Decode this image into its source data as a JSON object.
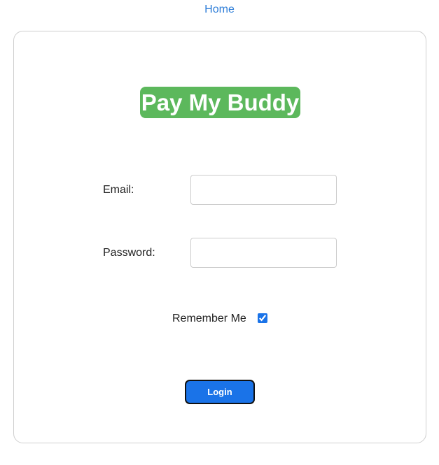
{
  "nav": {
    "home_label": "Home"
  },
  "brand": {
    "title": "Pay My Buddy",
    "color": "#5cb85c"
  },
  "form": {
    "email_label": "Email:",
    "email_value": "",
    "email_placeholder": "",
    "password_label": "Password:",
    "password_value": "",
    "password_placeholder": "",
    "remember_label": "Remember Me",
    "remember_checked": true,
    "login_label": "Login"
  },
  "colors": {
    "link": "#2f7ed8",
    "button": "#1a73e8",
    "border": "#cfcfcf"
  }
}
